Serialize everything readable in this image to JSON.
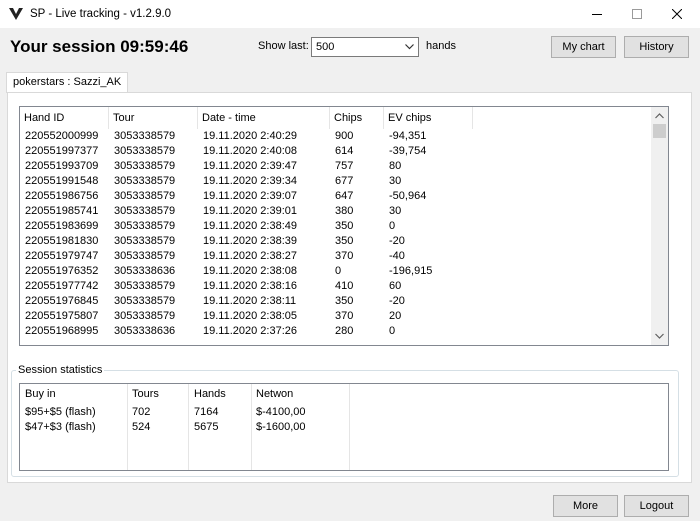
{
  "window": {
    "title": "SP - Live tracking - v1.2.9.0"
  },
  "header": {
    "session_title": "Your session 09:59:46",
    "show_last_label": "Show last:",
    "show_last_value": "500",
    "hands_label": "hands",
    "my_chart_label": "My chart",
    "history_label": "History"
  },
  "tab": {
    "label": "pokerstars : Sazzi_AK"
  },
  "hands_table": {
    "columns": [
      "Hand ID",
      "Tour",
      "Date - time",
      "Chips",
      "EV chips"
    ],
    "rows": [
      [
        "220552000999",
        "3053338579",
        "19.11.2020 2:40:29",
        "900",
        "-94,351"
      ],
      [
        "220551997377",
        "3053338579",
        "19.11.2020 2:40:08",
        "614",
        "-39,754"
      ],
      [
        "220551993709",
        "3053338579",
        "19.11.2020 2:39:47",
        "757",
        "80"
      ],
      [
        "220551991548",
        "3053338579",
        "19.11.2020 2:39:34",
        "677",
        "30"
      ],
      [
        "220551986756",
        "3053338579",
        "19.11.2020 2:39:07",
        "647",
        "-50,964"
      ],
      [
        "220551985741",
        "3053338579",
        "19.11.2020 2:39:01",
        "380",
        "30"
      ],
      [
        "220551983699",
        "3053338579",
        "19.11.2020 2:38:49",
        "350",
        "0"
      ],
      [
        "220551981830",
        "3053338579",
        "19.11.2020 2:38:39",
        "350",
        "-20"
      ],
      [
        "220551979747",
        "3053338579",
        "19.11.2020 2:38:27",
        "370",
        "-40"
      ],
      [
        "220551976352",
        "3053338636",
        "19.11.2020 2:38:08",
        "0",
        "-196,915"
      ],
      [
        "220551977742",
        "3053338579",
        "19.11.2020 2:38:16",
        "410",
        "60"
      ],
      [
        "220551976845",
        "3053338579",
        "19.11.2020 2:38:11",
        "350",
        "-20"
      ],
      [
        "220551975807",
        "3053338579",
        "19.11.2020 2:38:05",
        "370",
        "20"
      ],
      [
        "220551968995",
        "3053338636",
        "19.11.2020 2:37:26",
        "280",
        "0"
      ]
    ]
  },
  "session_stats": {
    "legend": "Session statistics",
    "columns": [
      "Buy in",
      "Tours",
      "Hands",
      "Netwon"
    ],
    "rows": [
      [
        "$95+$5 (flash)",
        "702",
        "7164",
        "$-4100,00"
      ],
      [
        "$47+$3 (flash)",
        "524",
        "5675",
        "$-1600,00"
      ]
    ]
  },
  "footer": {
    "more_label": "More",
    "logout_label": "Logout"
  }
}
